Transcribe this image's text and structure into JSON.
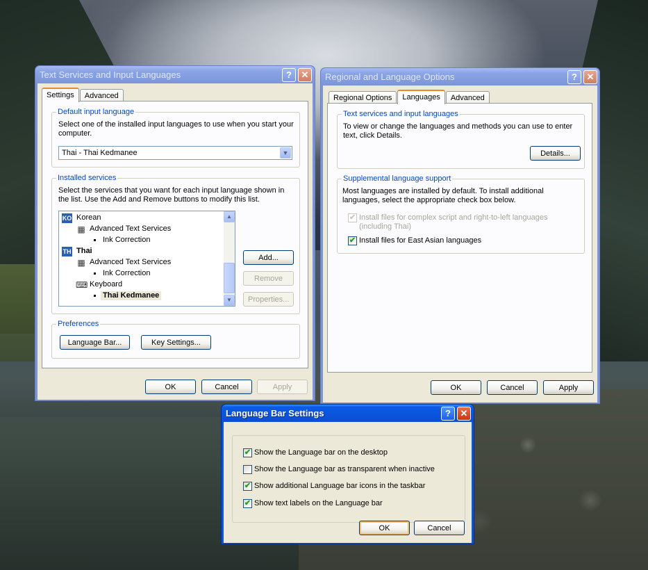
{
  "windows": {
    "text_services": {
      "title": "Text Services and Input Languages",
      "help_glyph": "?",
      "close_glyph": "✕",
      "tabs": [
        {
          "label": "Settings",
          "active": true
        },
        {
          "label": "Advanced",
          "active": false
        }
      ],
      "default_input": {
        "legend": "Default input language",
        "desc": "Select one of the installed input languages to use when you start your computer.",
        "selected": "Thai - Thai Kedmanee"
      },
      "installed_services": {
        "legend": "Installed services",
        "desc": "Select the services that you want for each input language shown in the list. Use the Add and Remove buttons to modify this list.",
        "items": {
          "korean_badge": "KO",
          "korean": "Korean",
          "korean_ats": "Advanced Text Services",
          "korean_ink": "Ink Correction",
          "thai_badge": "TH",
          "thai": "Thai",
          "thai_ats": "Advanced Text Services",
          "thai_ink": "Ink Correction",
          "keyboard": "Keyboard",
          "thai_kedmanee": "Thai Kedmanee"
        },
        "add": "Add...",
        "remove": "Remove",
        "properties": "Properties..."
      },
      "preferences": {
        "legend": "Preferences",
        "language_bar": "Language Bar...",
        "key_settings": "Key Settings..."
      },
      "ok": "OK",
      "cancel": "Cancel",
      "apply": "Apply"
    },
    "regional": {
      "title": "Regional and Language Options",
      "help_glyph": "?",
      "close_glyph": "✕",
      "tabs": [
        {
          "label": "Regional Options",
          "active": false
        },
        {
          "label": "Languages",
          "active": true
        },
        {
          "label": "Advanced",
          "active": false
        }
      ],
      "text_services": {
        "legend": "Text services and input languages",
        "desc": "To view or change the languages and methods you can use to enter text, click Details.",
        "details": "Details..."
      },
      "supplemental": {
        "legend": "Supplemental language support",
        "desc": "Most languages are installed by default. To install additional languages, select the appropriate check box below.",
        "complex_script": "Install files for complex script and right-to-left languages (including Thai)",
        "east_asian": "Install files for East Asian languages"
      },
      "ok": "OK",
      "cancel": "Cancel",
      "apply": "Apply"
    },
    "language_bar": {
      "title": "Language Bar Settings",
      "help_glyph": "?",
      "close_glyph": "✕",
      "options": {
        "show_desktop": "Show the Language bar on the desktop",
        "transparent": "Show the Language bar as transparent when inactive",
        "additional_icons": "Show additional Language bar icons in the taskbar",
        "text_labels": "Show text labels on the Language bar"
      },
      "ok": "OK",
      "cancel": "Cancel"
    }
  },
  "glyphs": {
    "check": "✔",
    "dropdown": "▼",
    "scroll_up": "▲",
    "scroll_down": "▼",
    "service_icon": "▦",
    "keyboard_icon": "⌨"
  },
  "colors": {
    "title_active": "#0a54dd",
    "title_inactive": "#7c95d8",
    "dialog_bg": "#ece9d8",
    "legend_blue": "#0046d5"
  }
}
